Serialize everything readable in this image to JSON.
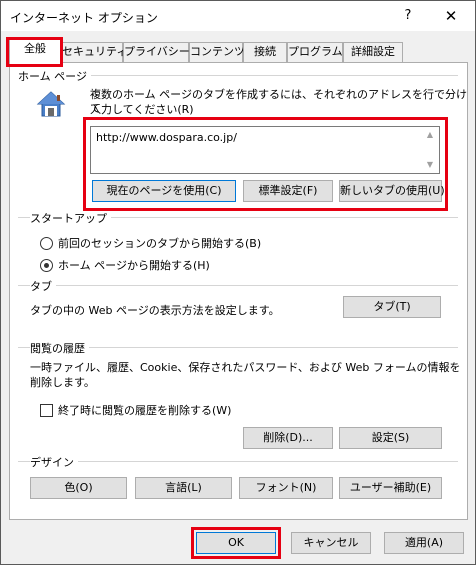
{
  "window": {
    "title": "インターネット オプション",
    "help_glyph": "?",
    "close_glyph": "✕"
  },
  "tabs": [
    {
      "label": "全般",
      "active": true
    },
    {
      "label": "セキュリティ"
    },
    {
      "label": "プライバシー"
    },
    {
      "label": "コンテンツ"
    },
    {
      "label": "接続"
    },
    {
      "label": "プログラム"
    },
    {
      "label": "詳細設定"
    }
  ],
  "home": {
    "group_label": "ホーム ページ",
    "desc_line1": "複数のホーム ページのタブを作成するには、それぞれのアドレスを行で分けて",
    "desc_line2": "入力してください(R)",
    "url": "http://www.dospara.co.jp/",
    "btn_current": "現在のページを使用(C)",
    "btn_default": "標準設定(F)",
    "btn_newtab": "新しいタブの使用(U)"
  },
  "startup": {
    "group_label": "スタートアップ",
    "option1": "前回のセッションのタブから開始する(B)",
    "option2": "ホーム ページから開始する(H)",
    "selected": 2
  },
  "tabsection": {
    "group_label": "タブ",
    "desc": "タブの中の Web ページの表示方法を設定します。",
    "btn": "タブ(T)"
  },
  "history": {
    "group_label": "閲覧の履歴",
    "desc_line1": "一時ファイル、履歴、Cookie、保存されたパスワード、および Web フォームの情報を",
    "desc_line2": "削除します。",
    "checkbox_label": "終了時に閲覧の履歴を削除する(W)",
    "checked": false,
    "btn_delete": "削除(D)...",
    "btn_settings": "設定(S)"
  },
  "design": {
    "group_label": "デザイン",
    "btn_color": "色(O)",
    "btn_lang": "言語(L)",
    "btn_font": "フォント(N)",
    "btn_access": "ユーザー補助(E)"
  },
  "footer": {
    "ok": "OK",
    "cancel": "キャンセル",
    "apply": "適用(A)"
  },
  "colors": {
    "highlight": "#e60012",
    "focus": "#0078d7"
  },
  "icons": {
    "home": "house-icon"
  }
}
